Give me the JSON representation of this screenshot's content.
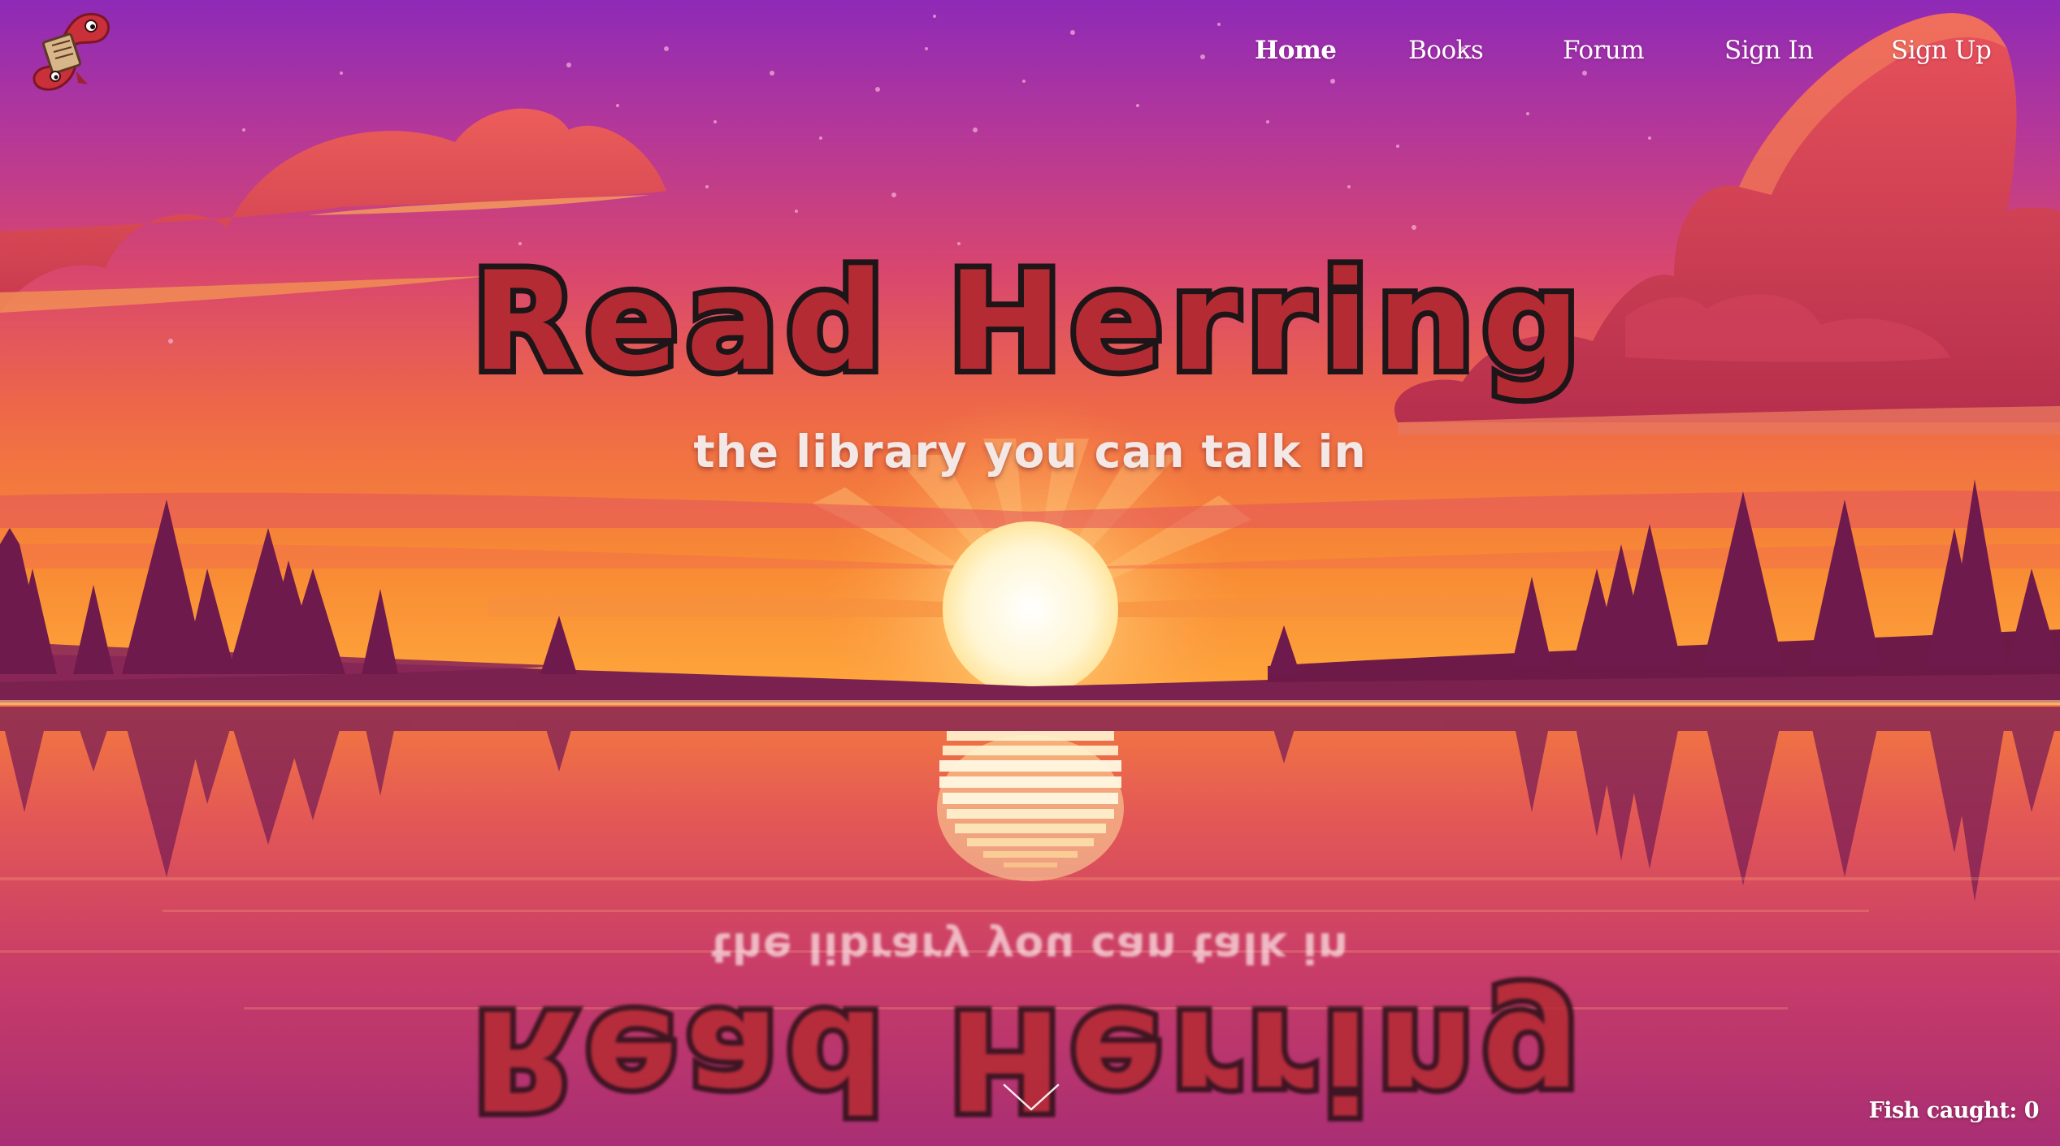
{
  "brand": {
    "logo_icon": "red-herring-fish-with-book-icon"
  },
  "nav": {
    "items": [
      {
        "label": "Home",
        "active": true
      },
      {
        "label": "Books",
        "active": false
      },
      {
        "label": "Forum",
        "active": false
      },
      {
        "label": "Sign In",
        "active": false
      },
      {
        "label": "Sign Up",
        "active": false
      }
    ]
  },
  "hero": {
    "title": "Read Herring",
    "subtitle": "the library you can talk in"
  },
  "scroll_icon": "chevron-down-icon",
  "fish_counter": {
    "label": "Fish caught: 0"
  },
  "colors": {
    "sky_top": "#9a2fb0",
    "sky_mid": "#e0466a",
    "horizon": "#ff8a3a",
    "sun": "#fff6d0",
    "trees": "#6e1a4c",
    "water": "#c43a6a",
    "title_fill": "#b52b33",
    "title_outline": "#1d1517",
    "subtitle": "#f4e8e6"
  }
}
